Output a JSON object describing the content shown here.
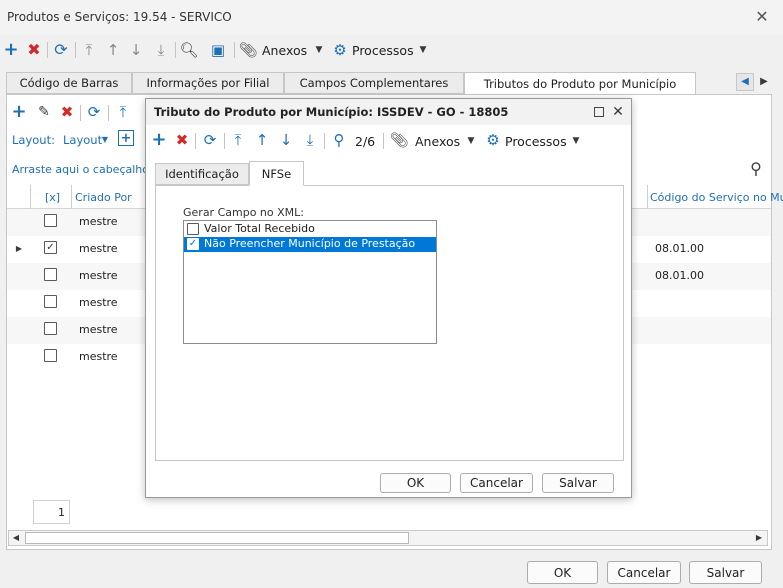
{
  "window": {
    "title": "Produtos e Serviços: 19.54 - SERVICO"
  },
  "toolbar": {
    "anexos": "Anexos",
    "processos": "Processos"
  },
  "tabs": [
    {
      "label": "Código de Barras"
    },
    {
      "label": "Informações por Filial"
    },
    {
      "label": "Campos Complementares"
    },
    {
      "label": "Tributos do Produto por Município"
    }
  ],
  "grid": {
    "layout_label": "Layout:",
    "layout_menu": "Layout",
    "group_hint": "Arraste aqui o cabeçalho de",
    "columns": {
      "check": "[x]",
      "criado_por": "Criado Por",
      "codigo_servico": "Código do Serviço no Mu"
    },
    "rows": [
      {
        "checked": false,
        "criado_por": "mestre",
        "codigo": ""
      },
      {
        "checked": true,
        "criado_por": "mestre",
        "codigo": "08.01.00"
      },
      {
        "checked": false,
        "criado_por": "mestre",
        "codigo": "08.01.00"
      },
      {
        "checked": false,
        "criado_por": "mestre",
        "codigo": ""
      },
      {
        "checked": false,
        "criado_por": "mestre",
        "codigo": ""
      },
      {
        "checked": false,
        "criado_por": "mestre",
        "codigo": ""
      }
    ],
    "page": "1"
  },
  "dialog": {
    "title": "Tributo do Produto por Município: ISSDEV - GO - 18805",
    "record_position": "2/6",
    "anexos": "Anexos",
    "processos": "Processos",
    "tabs": [
      {
        "label": "Identificação"
      },
      {
        "label": "NFSe"
      }
    ],
    "xml_label": "Gerar Campo no XML:",
    "options": [
      {
        "label": "Valor Total Recebido",
        "checked": false,
        "selected": false
      },
      {
        "label": "Não Preencher Município de Prestação",
        "checked": true,
        "selected": true
      }
    ],
    "buttons": {
      "ok": "OK",
      "cancel": "Cancelar",
      "save": "Salvar"
    }
  },
  "footer": {
    "ok": "OK",
    "cancel": "Cancelar",
    "save": "Salvar"
  },
  "colors": {
    "accent": "#1f6fb5",
    "selection": "#0078d7",
    "delete": "#d22a2a"
  }
}
